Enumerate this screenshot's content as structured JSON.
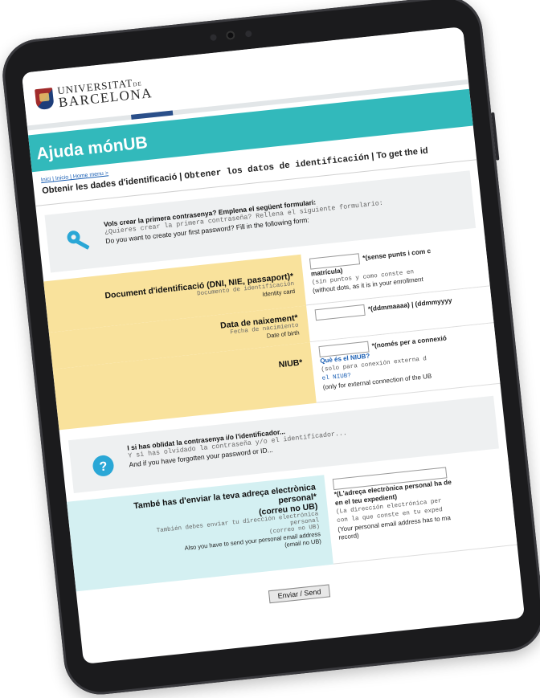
{
  "header": {
    "logo_line1": "UNIVERSITAT",
    "logo_line1_suffix": "DE",
    "logo_line2": "BARCELONA"
  },
  "page": {
    "title": "Ajuda mónUB",
    "breadcrumb": "Inici | Inicio | Home menu >",
    "section_title_ca": "Obtenir les dades d'identificació |",
    "section_title_es": "Obtener los datos de identificación",
    "section_title_en": "| To get the id"
  },
  "info_first": {
    "icon": "key-icon",
    "ca": "Vols crear la primera contrasenya? Emplena el següent formulari:",
    "es": "¿Quieres crear la primera contraseña? Rellena el siguiente formulario:",
    "en": "Do you want to create your first password? Fill in the following form:"
  },
  "fields": {
    "document": {
      "label_ca": "Document d'identificació (DNI, NIE, passaport)*",
      "label_es": "Documento de identificación",
      "label_en": "Identity card",
      "note_b1": "*(sense punts i com c",
      "note_b2": "matrícula)",
      "note_es": "(sin puntos y como conste en",
      "note_en": "(without dots, as it is in your enrollment"
    },
    "birth": {
      "label_ca": "Data de naixement*",
      "label_es": "Fecha de nacimiento",
      "label_en": "Date of birth",
      "note": "*(ddmmaaaa) | (ddmmyyyy"
    },
    "niub": {
      "label": "NIUB*",
      "note_b": "*(només per a connexió",
      "link": "Què és el NIUB?",
      "note_es1": "(solo para conexión externa d",
      "note_es2": "el NIUB?",
      "note_en": "(only for external connection of the UB"
    },
    "email": {
      "label_ca1": "També has d'enviar la teva adreça electrònica",
      "label_ca2": "personal*",
      "label_ca3": "(correu no UB)",
      "label_es1": "También debes enviar tu dirección electrónica",
      "label_es2": "personal",
      "label_es3": "(correo no UB)",
      "label_en1": "Also you have to send your personal email address",
      "label_en2": "(email no UB)",
      "note_b1": "*(L'adreça electrònica personal ha de",
      "note_b2": "en el teu expedient)",
      "note_es1": "(La dirección electrónica per",
      "note_es2": "con la que conste en tu exped",
      "note_en1": "(Your personal email address has to ma",
      "note_en2": "record)"
    }
  },
  "info_forgot": {
    "icon": "question-icon",
    "ca": "I si has oblidat la contrasenya i/o l'identificador...",
    "es": "Y si has olvidado la contraseña y/o el identificador...",
    "en": "And if you have forgotten your password or ID..."
  },
  "send_button": "Enviar / Send",
  "colors": {
    "teal": "#32b9bb",
    "yellow": "#f9e29c",
    "light_blue": "#d4f0f2"
  }
}
